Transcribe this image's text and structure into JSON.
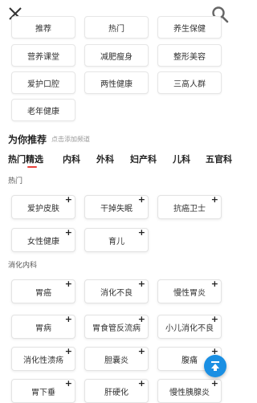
{
  "header": {
    "close_icon": "close-icon",
    "search_icon": "search-icon"
  },
  "my_channels": [
    "推荐",
    "热门",
    "养生保健",
    "营养课堂",
    "减肥瘦身",
    "整形美容",
    "爱护口腔",
    "两性健康",
    "三高人群",
    "老年健康"
  ],
  "recommend": {
    "title": "为你推荐",
    "hint": "点击添加频道"
  },
  "tabs": [
    "热门精选",
    "内科",
    "外科",
    "妇产科",
    "儿科",
    "五官科"
  ],
  "active_tab": "热门精选",
  "sections": {
    "hot": {
      "label": "热门",
      "items": [
        "爱护皮肤",
        "干掉失眠",
        "抗癌卫士",
        "女性健康",
        "育儿"
      ]
    },
    "digestive": {
      "label": "消化内科",
      "items": [
        "胃癌",
        "消化不良",
        "慢性胃炎",
        "胃病",
        "胃食管反流病",
        "小儿消化不良",
        "消化性溃疡",
        "胆囊炎",
        "腹痛",
        "胃下垂",
        "肝硬化",
        "慢性胰腺炎"
      ]
    }
  },
  "plus_symbol": "+",
  "accent_color": "#e8403a",
  "fab_color": "#1a8fe3"
}
